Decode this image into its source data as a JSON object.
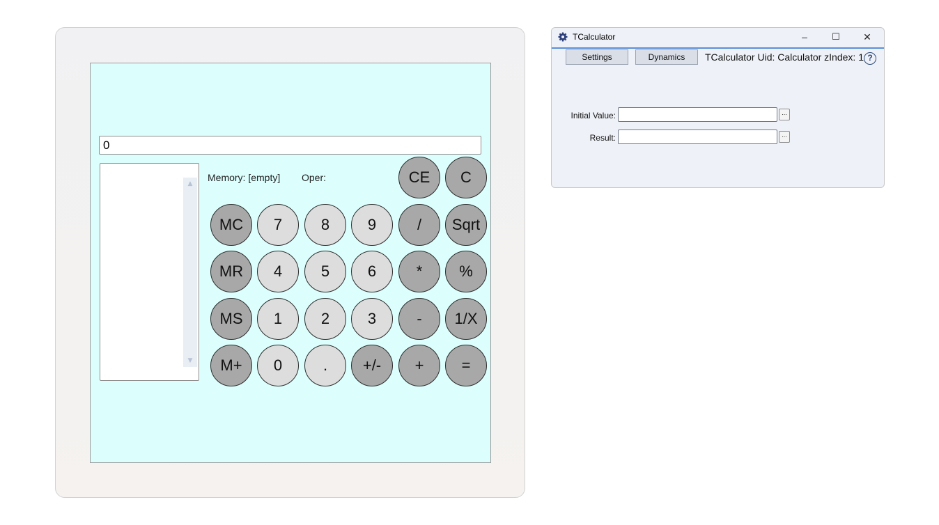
{
  "calculator": {
    "display_value": "0",
    "memory_label": "Memory: [empty]",
    "oper_label": "Oper:",
    "scroll_up": "▲",
    "scroll_down": "▼",
    "buttons": {
      "ce": "CE",
      "c": "C",
      "mc": "MC",
      "n7": "7",
      "n8": "8",
      "n9": "9",
      "div": "/",
      "sqrt": "Sqrt",
      "mr": "MR",
      "n4": "4",
      "n5": "5",
      "n6": "6",
      "mul": "*",
      "pct": "%",
      "ms": "MS",
      "n1": "1",
      "n2": "2",
      "n3": "3",
      "sub": "-",
      "inv": "1/X",
      "mplus": "M+",
      "n0": "0",
      "dot": ".",
      "neg": "+/-",
      "add": "+",
      "eq": "="
    },
    "colors": {
      "panel": "#dcfffe",
      "light_button": "#dddddd",
      "dark_button": "#a8a8a8"
    }
  },
  "window": {
    "title": "TCalculator",
    "minimize": "–",
    "maximize": "☐",
    "close": "✕",
    "tabs": {
      "settings": "Settings",
      "dynamics": "Dynamics"
    },
    "uid_text": "TCalculator Uid: Calculator zIndex: 1",
    "help": "?",
    "fields": {
      "initial_value_label": "Initial Value:",
      "initial_value": "",
      "result_label": "Result:",
      "result": "",
      "browse": "..."
    },
    "colors": {
      "accent": "#5a8fd8",
      "background": "#eef1f7"
    }
  }
}
